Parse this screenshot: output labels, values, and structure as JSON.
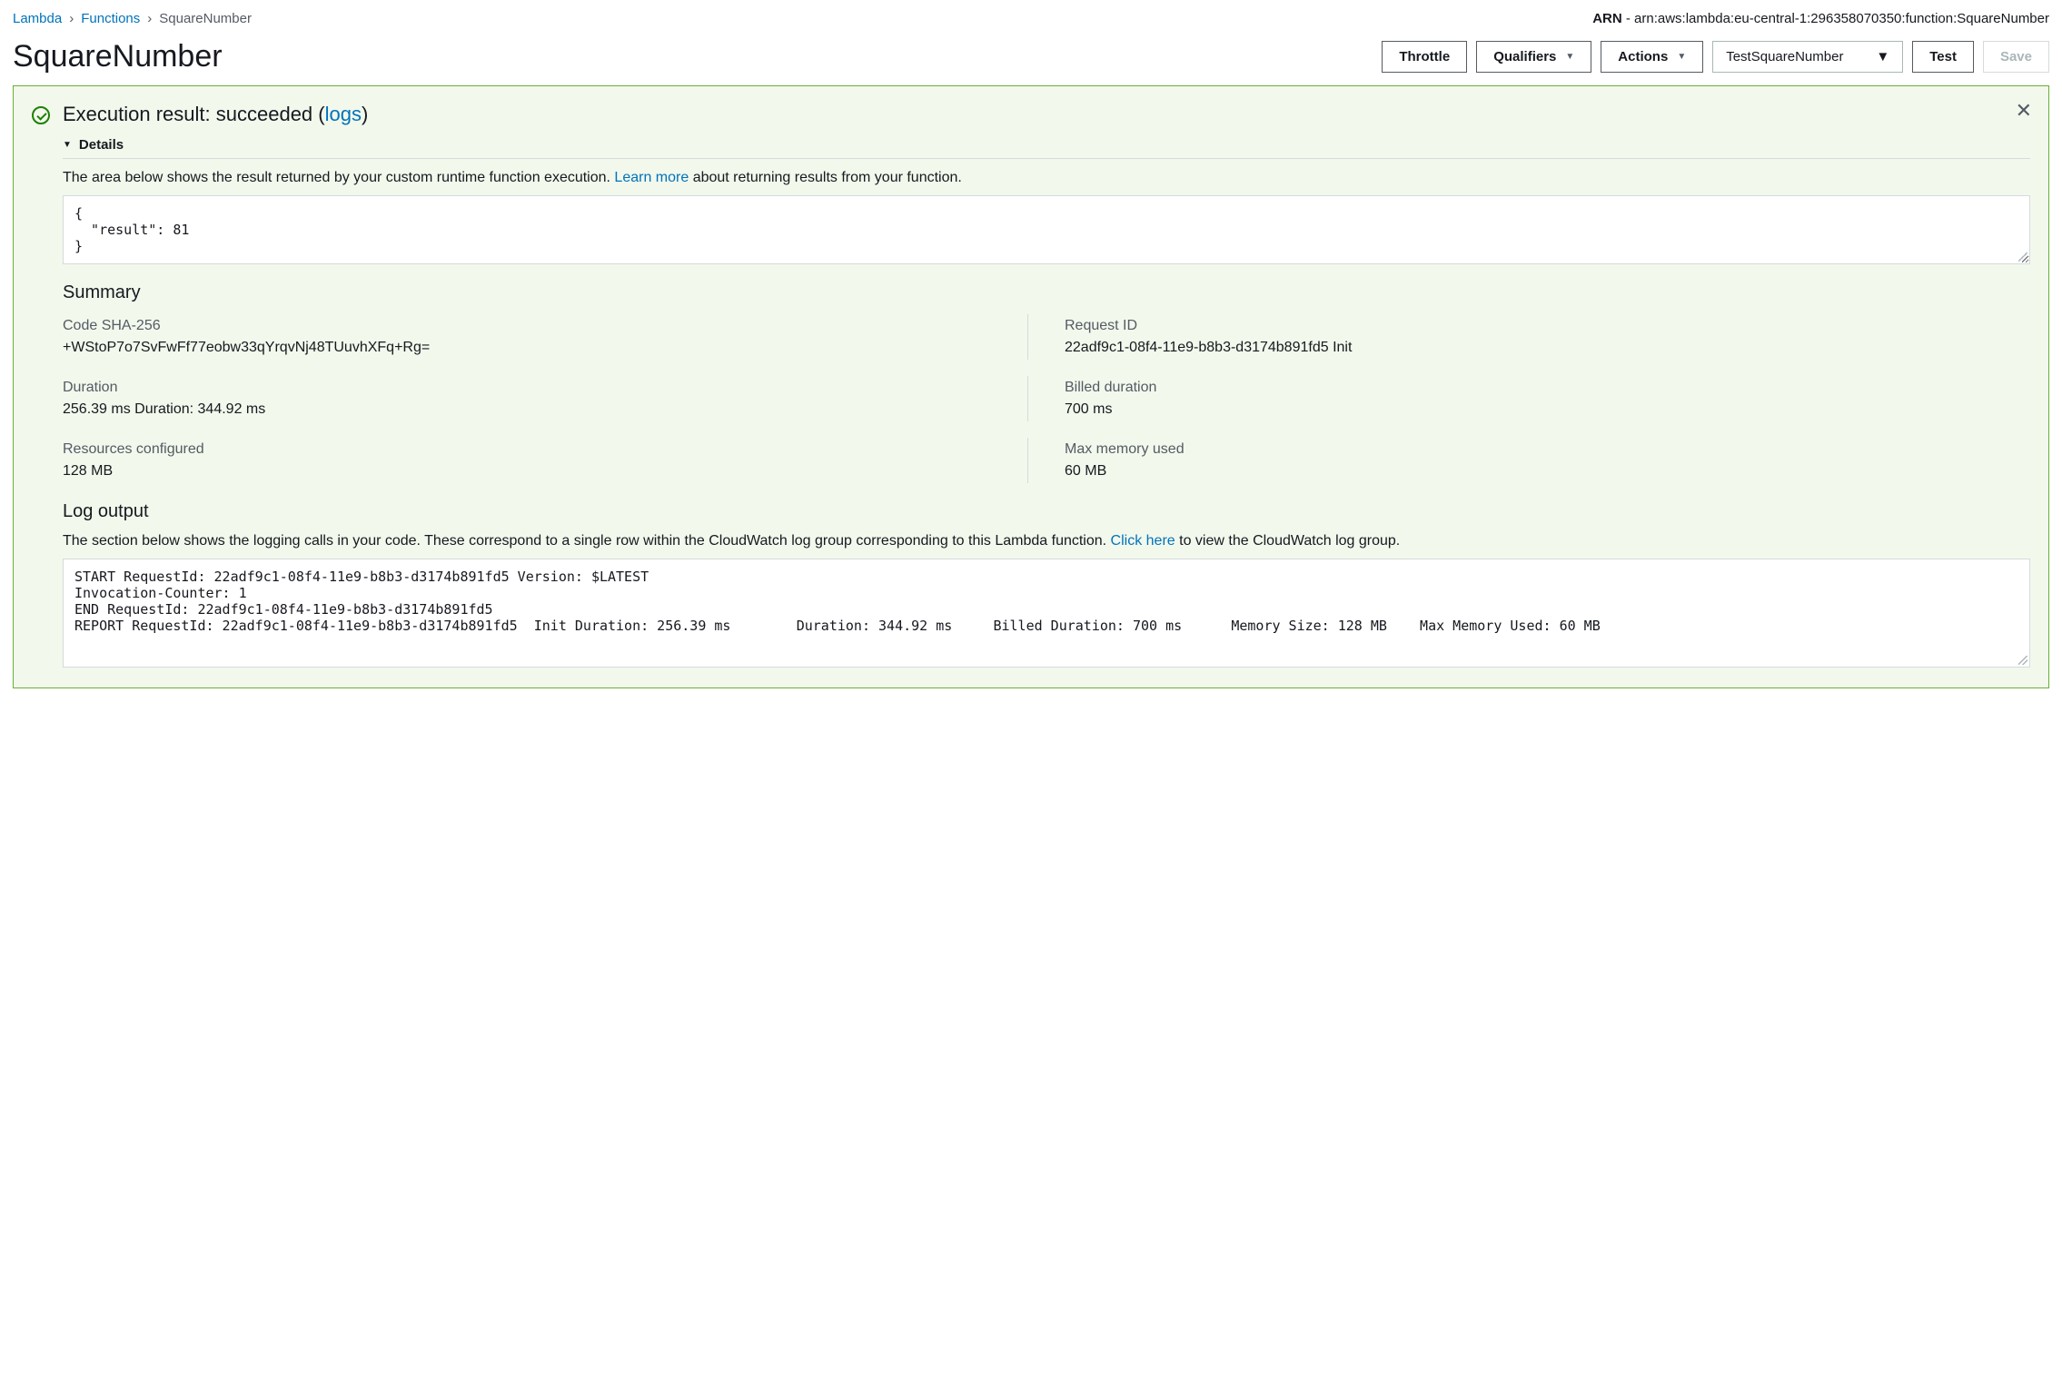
{
  "breadcrumb": {
    "root": "Lambda",
    "section": "Functions",
    "current": "SquareNumber"
  },
  "arn": {
    "label": "ARN",
    "sep": " - ",
    "value": "arn:aws:lambda:eu-central-1:296358070350:function:SquareNumber"
  },
  "title": "SquareNumber",
  "toolbar": {
    "throttle": "Throttle",
    "qualifiers": "Qualifiers",
    "actions": "Actions",
    "test_event_selected": "TestSquareNumber",
    "test": "Test",
    "save": "Save"
  },
  "result": {
    "title_prefix": "Execution result: succeeded (",
    "logs_link": "logs",
    "title_suffix": ")",
    "details_label": "Details",
    "desc_prefix": "The area below shows the result returned by your custom runtime function execution. ",
    "learn_more": "Learn more",
    "desc_suffix": " about returning results from your function.",
    "payload": "{\n  \"result\": 81\n}"
  },
  "summary": {
    "heading": "Summary",
    "code_sha_label": "Code SHA-256",
    "code_sha_value": "+WStoP7o7SvFwFf77eobw33qYrqvNj48TUuvhXFq+Rg=",
    "request_id_label": "Request ID",
    "request_id_value": "22adf9c1-08f4-11e9-b8b3-d3174b891fd5 Init",
    "duration_label": "Duration",
    "duration_value": "256.39 ms Duration: 344.92 ms",
    "billed_label": "Billed duration",
    "billed_value": "700 ms",
    "resources_label": "Resources configured",
    "resources_value": "128 MB",
    "maxmem_label": "Max memory used",
    "maxmem_value": "60 MB"
  },
  "log": {
    "heading": "Log output",
    "desc_prefix": "The section below shows the logging calls in your code. These correspond to a single row within the CloudWatch log group corresponding to this Lambda function. ",
    "click_here": "Click here",
    "desc_suffix": " to view the CloudWatch log group.",
    "content": "START RequestId: 22adf9c1-08f4-11e9-b8b3-d3174b891fd5 Version: $LATEST\nInvocation-Counter: 1\nEND RequestId: 22adf9c1-08f4-11e9-b8b3-d3174b891fd5\nREPORT RequestId: 22adf9c1-08f4-11e9-b8b3-d3174b891fd5  Init Duration: 256.39 ms        Duration: 344.92 ms     Billed Duration: 700 ms      Memory Size: 128 MB    Max Memory Used: 60 MB"
  }
}
